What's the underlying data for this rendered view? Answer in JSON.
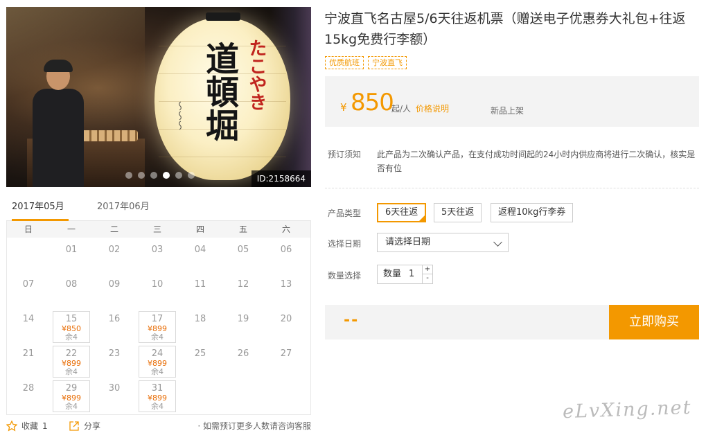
{
  "gallery": {
    "lantern_main": "道頓堀",
    "lantern_red": "たこやき",
    "image_id": "ID:2158664",
    "dots": 6,
    "active_dot": 3
  },
  "calendar": {
    "tabs": [
      "2017年05月",
      "2017年06月"
    ],
    "active_tab": 0,
    "weekdays": [
      "日",
      "一",
      "二",
      "三",
      "四",
      "五",
      "六"
    ],
    "days": [
      {
        "d": ""
      },
      {
        "d": "01"
      },
      {
        "d": "02"
      },
      {
        "d": "03"
      },
      {
        "d": "04"
      },
      {
        "d": "05"
      },
      {
        "d": "06"
      },
      {
        "d": "07"
      },
      {
        "d": "08"
      },
      {
        "d": "09"
      },
      {
        "d": "10"
      },
      {
        "d": "11"
      },
      {
        "d": "12"
      },
      {
        "d": "13"
      },
      {
        "d": "14"
      },
      {
        "d": "15",
        "price": "¥850",
        "stock": "余4"
      },
      {
        "d": "16"
      },
      {
        "d": "17",
        "price": "¥899",
        "stock": "余4"
      },
      {
        "d": "18"
      },
      {
        "d": "19"
      },
      {
        "d": "20"
      },
      {
        "d": "21"
      },
      {
        "d": "22",
        "price": "¥899",
        "stock": "余4"
      },
      {
        "d": "23"
      },
      {
        "d": "24",
        "price": "¥899",
        "stock": "余4"
      },
      {
        "d": "25"
      },
      {
        "d": "26"
      },
      {
        "d": "27"
      },
      {
        "d": "28"
      },
      {
        "d": "29",
        "price": "¥899",
        "stock": "余4"
      },
      {
        "d": "30"
      },
      {
        "d": "31",
        "price": "¥899",
        "stock": "余4"
      }
    ]
  },
  "actions": {
    "favorite_label": "收藏",
    "favorite_count": "1",
    "share_label": "分享",
    "tip": "· 如需预订更多人数请咨询客服"
  },
  "product": {
    "title": "宁波直飞名古屋5/6天往返机票（赠送电子优惠券大礼包+往返15kg免费行李额）",
    "tags": [
      "优质航班",
      "宁波直飞"
    ],
    "currency": "¥",
    "price": "850",
    "unit": "起/人",
    "price_explain": "价格说明",
    "status": "新品上架",
    "notice_label": "预订须知",
    "notice_text": "此产品为二次确认产品，在支付成功时间起的24小时内供应商将进行二次确认，核实是否有位",
    "type_label": "产品类型",
    "types": [
      "6天往返",
      "5天往返",
      "返程10kg行李券"
    ],
    "selected_type": 0,
    "date_label": "选择日期",
    "date_placeholder": "请选择日期",
    "qty_label": "数量选择",
    "qty_prefix": "数量",
    "qty_value": "1",
    "plus": "+",
    "minus": "-",
    "total": "--",
    "buy_label": "立即购买"
  },
  "watermark": "eLvXing.net",
  "colors": {
    "accent": "#f39800",
    "price_red": "#e86a00"
  }
}
